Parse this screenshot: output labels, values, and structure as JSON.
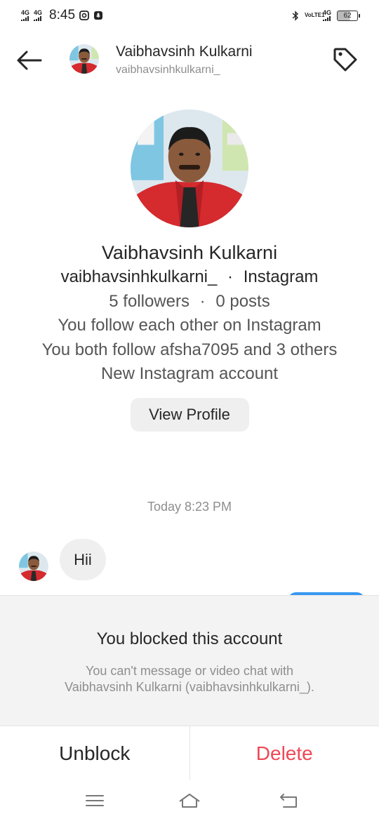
{
  "status_bar": {
    "network_1": "4G",
    "network_2": "4G",
    "time": "8:45",
    "volte": "VoLTE1",
    "network_right": "4G",
    "battery": "62"
  },
  "header": {
    "name": "Vaibhavsinh Kulkarni",
    "username": "vaibhavsinhkulkarni_"
  },
  "profile": {
    "name": "Vaibhavsinh Kulkarni",
    "username": "vaibhavsinhkulkarni_",
    "platform_sep": "·",
    "platform": "Instagram",
    "followers": "5 followers",
    "stats_sep": "·",
    "posts": "0 posts",
    "mutual_follow": "You follow each other on Instagram",
    "mutual_friends": "You both follow afsha7095 and 3 others",
    "account_status": "New Instagram account",
    "view_profile_label": "View Profile"
  },
  "chat": {
    "timestamp": "Today 8:23 PM",
    "messages": [
      {
        "sender": "them",
        "text": "Hii"
      }
    ]
  },
  "blocked": {
    "title": "You blocked this account",
    "description_line1": "You can't message or video chat with",
    "description_line2": "Vaibhavsinh Kulkarni (vaibhavsinhkulkarni_)."
  },
  "actions": {
    "unblock_label": "Unblock",
    "delete_label": "Delete"
  },
  "colors": {
    "delete": "#ed4956",
    "bubble": "#efefef",
    "panel": "#f3f3f3",
    "outgoing_bubble": "#3797f0"
  },
  "icons": {
    "back": "arrow-left-icon",
    "tag": "tag-icon",
    "nav_menu": "menu-icon",
    "nav_home": "home-icon",
    "nav_back": "return-icon"
  }
}
